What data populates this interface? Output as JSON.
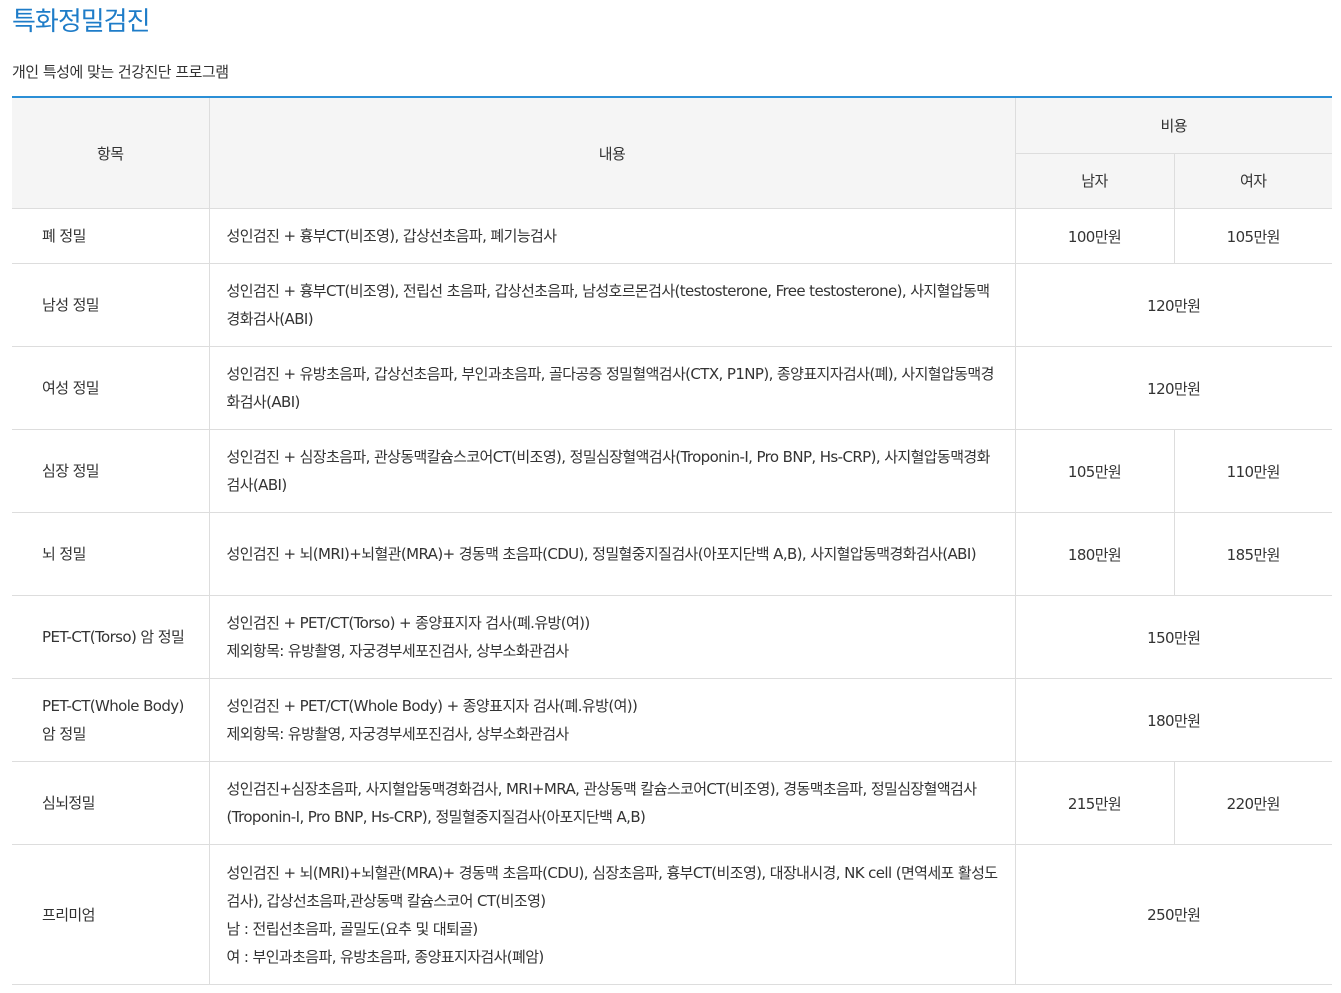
{
  "header": {
    "title": "특화정밀검진",
    "subtitle": "개인 특성에 맞는 건강진단 프로그램"
  },
  "table": {
    "columns": {
      "item": "항목",
      "content": "내용",
      "cost": "비용",
      "male": "남자",
      "female": "여자"
    },
    "rows": [
      {
        "item": [
          "폐 정밀"
        ],
        "content": [
          "성인검진 + 흉부CT(비조영), 갑상선초음파, 폐기능검사"
        ],
        "male": "100만원",
        "female": "105만원"
      },
      {
        "item": [
          "남성 정밀"
        ],
        "content": [
          "성인검진 + 흉부CT(비조영), 전립선 초음파, 갑상선초음파, 남성호르몬검사(testosterone, Free testosterone), 사지혈압동맥경화검사(ABI)"
        ],
        "price": "120만원"
      },
      {
        "item": [
          "여성 정밀"
        ],
        "content": [
          "성인검진 + 유방초음파, 갑상선초음파, 부인과초음파, 골다공증 정밀혈액검사(CTX, P1NP), 종양표지자검사(폐), 사지혈압동맥경화검사(ABI)"
        ],
        "price": "120만원"
      },
      {
        "item": [
          "심장 정밀"
        ],
        "content": [
          "성인검진 + 심장초음파, 관상동맥칼슘스코어CT(비조영), 정밀심장혈액검사(Troponin-I, Pro BNP, Hs-CRP), 사지혈압동맥경화검사(ABI)"
        ],
        "male": "105만원",
        "female": "110만원"
      },
      {
        "item": [
          "뇌 정밀"
        ],
        "content": [
          "성인검진 + 뇌(MRI)+뇌혈관(MRA)+ 경동맥 초음파(CDU), 정밀혈중지질검사(아포지단백 A,B), 사지혈압동맥경화검사(ABI)"
        ],
        "male": "180만원",
        "female": "185만원"
      },
      {
        "item": [
          "PET-CT(Torso) 암 정밀"
        ],
        "content": [
          "성인검진 + PET/CT(Torso) + 종양표지자 검사(폐.유방(여))",
          "제외항목: 유방촬영, 자궁경부세포진검사, 상부소화관검사"
        ],
        "price": "150만원"
      },
      {
        "item": [
          "PET-CT(Whole Body)",
          "암 정밀"
        ],
        "content": [
          "성인검진 + PET/CT(Whole Body) + 종양표지자 검사(폐.유방(여))",
          "제외항목: 유방촬영, 자궁경부세포진검사, 상부소화관검사"
        ],
        "price": "180만원"
      },
      {
        "item": [
          "심뇌정밀"
        ],
        "content": [
          "성인검진+심장초음파, 사지혈압동맥경화검사, MRI+MRA, 관상동맥 칼슘스코어CT(비조영), 경동맥초음파, 정밀심장혈액검사(Troponin-I, Pro BNP, Hs-CRP), 정밀혈중지질검사(아포지단백 A,B)"
        ],
        "male": "215만원",
        "female": "220만원"
      },
      {
        "item": [
          "프리미엄"
        ],
        "content": [
          "성인검진 + 뇌(MRI)+뇌혈관(MRA)+ 경동맥 초음파(CDU), 심장초음파, 흉부CT(비조영), 대장내시경, NK cell (면역세포 활성도 검사), 갑상선초음파,관상동맥 칼슘스코어 CT(비조영)",
          "남 : 전립선초음파, 골밀도(요추 및 대퇴골)",
          "여 : 부인과초음파, 유방초음파, 종양표지자검사(폐암)"
        ],
        "price": "250만원"
      }
    ]
  }
}
